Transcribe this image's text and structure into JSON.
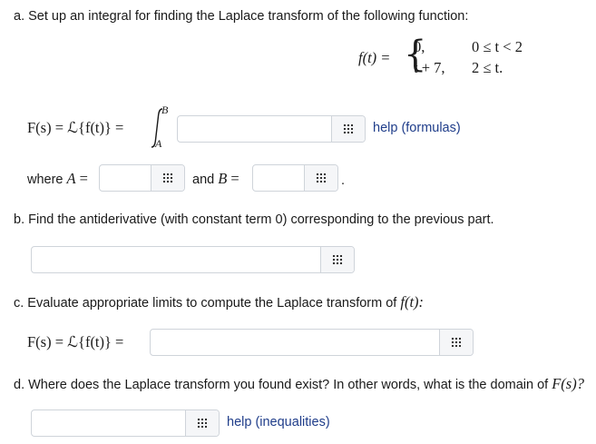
{
  "part_a": {
    "prompt": "a. Set up an integral for finding the Laplace transform of the following function:",
    "function_lhs": "f(t) =",
    "case1_value": "0,",
    "case1_cond": "0 ≤ t < 2",
    "case2_value": "t + 7,",
    "case2_cond": "2 ≤ t.",
    "integral_lhs": "F(s) = ℒ{f(t)} =",
    "integral_upper": "B",
    "integral_lower": "A",
    "help_formulas": "help (formulas)",
    "where_label": "where",
    "a_var": "A",
    "eq": "=",
    "and_label": "and",
    "b_var": "B",
    "period": "."
  },
  "part_b": {
    "prompt": "b. Find the antiderivative (with constant term 0) corresponding to the previous part."
  },
  "part_c": {
    "prompt_text": "c. Evaluate appropriate limits to compute the Laplace transform of",
    "prompt_math": "f(t):",
    "lhs": "F(s) = ℒ{f(t)} ="
  },
  "part_d": {
    "prompt_text": "d. Where does the Laplace transform you found exist? In other words, what is the domain of",
    "prompt_math": "F(s)?",
    "help_inequalities": "help (inequalities)"
  },
  "icons": {
    "keyboard": "grid-keypad-icon"
  }
}
